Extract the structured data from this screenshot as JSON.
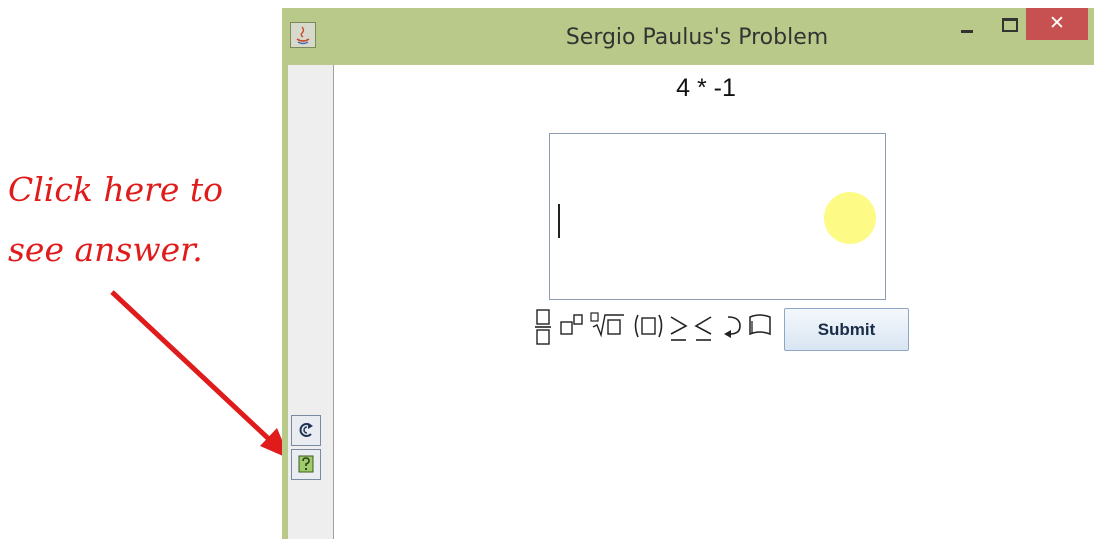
{
  "annotation": {
    "line1": "Click here to",
    "line2": "see answer."
  },
  "window": {
    "title": "Sergio Paulus's Problem",
    "close_glyph": "✕"
  },
  "problem": {
    "expression": "4 * -1"
  },
  "answer": {
    "value": ""
  },
  "toolbar": {
    "submit_label": "Submit",
    "symbols": [
      "fraction-icon",
      "exponent-icon",
      "nth-root-icon",
      "parentheses-icon",
      "greater-equal-icon",
      "less-equal-icon",
      "undo-icon",
      "clear-icon"
    ]
  },
  "side_toolbar": {
    "items": [
      "refresh-icon",
      "show-answer-icon"
    ]
  },
  "colors": {
    "titlebar": "#b9c98a",
    "close_button": "#c75050",
    "annotation": "#e01b1b",
    "highlight": "#fdfa7f"
  }
}
